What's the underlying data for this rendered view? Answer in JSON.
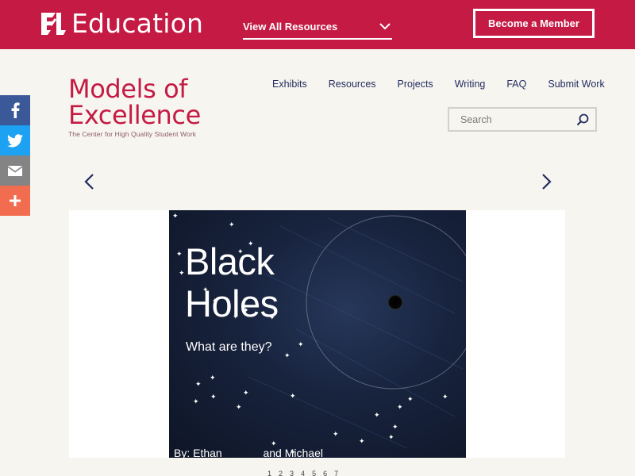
{
  "topbar": {
    "brand_text": "Education",
    "resources_label": "View All Resources",
    "member_label": "Become a Member",
    "accent": "#c41a44"
  },
  "logo": {
    "line1": "Models of",
    "line2": "Excellence",
    "tagline": "The Center for High Quality Student Work"
  },
  "nav": {
    "items": [
      "Exhibits",
      "Resources",
      "Projects",
      "Writing",
      "FAQ",
      "Submit Work"
    ]
  },
  "search": {
    "placeholder": "Search"
  },
  "social": {
    "icons": [
      "facebook-icon",
      "twitter-icon",
      "email-icon",
      "plus-icon"
    ]
  },
  "slide": {
    "title_line1": "Black",
    "title_line2": "Holes",
    "subtitle": "What are they?",
    "byline_left": "By: Ethan",
    "byline_right": "and Michael"
  },
  "pager": {
    "pages": [
      "1",
      "2",
      "3",
      "4",
      "5",
      "6",
      "7"
    ]
  }
}
